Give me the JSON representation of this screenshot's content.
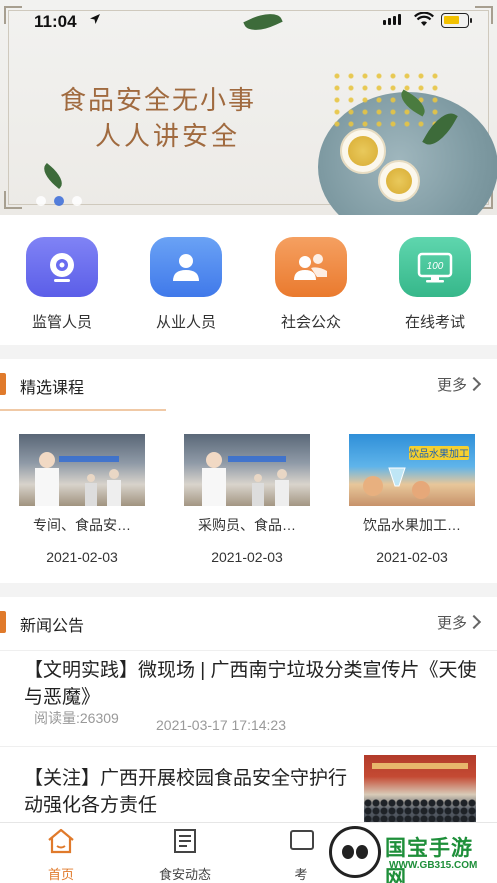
{
  "status_bar": {
    "time": "11:04"
  },
  "banner": {
    "line1": "食品安全无小事",
    "line2": "人人讲安全"
  },
  "quick_links": [
    {
      "label": "监管人员",
      "icon": "webcam-icon",
      "color": "#6a6cf0"
    },
    {
      "label": "从业人员",
      "icon": "person-icon",
      "color": "#4f8af0"
    },
    {
      "label": "社会公众",
      "icon": "people-icon",
      "color": "#f08a3a"
    },
    {
      "label": "在线考试",
      "icon": "monitor-100-icon",
      "color": "#43c39a"
    }
  ],
  "courses_section": {
    "title": "精选课程",
    "more": "更多"
  },
  "courses": [
    {
      "name": "专间、食品安…",
      "date": "2021-02-03"
    },
    {
      "name": "采购员、食品…",
      "date": "2021-02-03"
    },
    {
      "name": "饮品水果加工…",
      "date": "2021-02-03",
      "thumb_text": "饮品水果加工"
    }
  ],
  "news_section": {
    "title": "新闻公告",
    "more": "更多"
  },
  "news": [
    {
      "title": "【文明实践】微现场 | 广西南宁垃圾分类宣传片《天使与恶魔》",
      "reads": "阅读量:26309",
      "time": "2021-03-17 17:14:23"
    },
    {
      "title": "【关注】广西开展校园食品安全守护行动强化各方责任"
    }
  ],
  "tabbar": [
    {
      "label": "首页",
      "icon": "home-icon",
      "active": true
    },
    {
      "label": "食安动态",
      "icon": "newspaper-icon",
      "active": false
    },
    {
      "label": "考",
      "icon": "exam-icon",
      "active": false
    }
  ],
  "watermark": {
    "text": "国宝手游网",
    "url": "WWW.GB315.COM"
  },
  "colors": {
    "accent": "#e07a2b",
    "carousel_active": "#3a6bd8"
  }
}
